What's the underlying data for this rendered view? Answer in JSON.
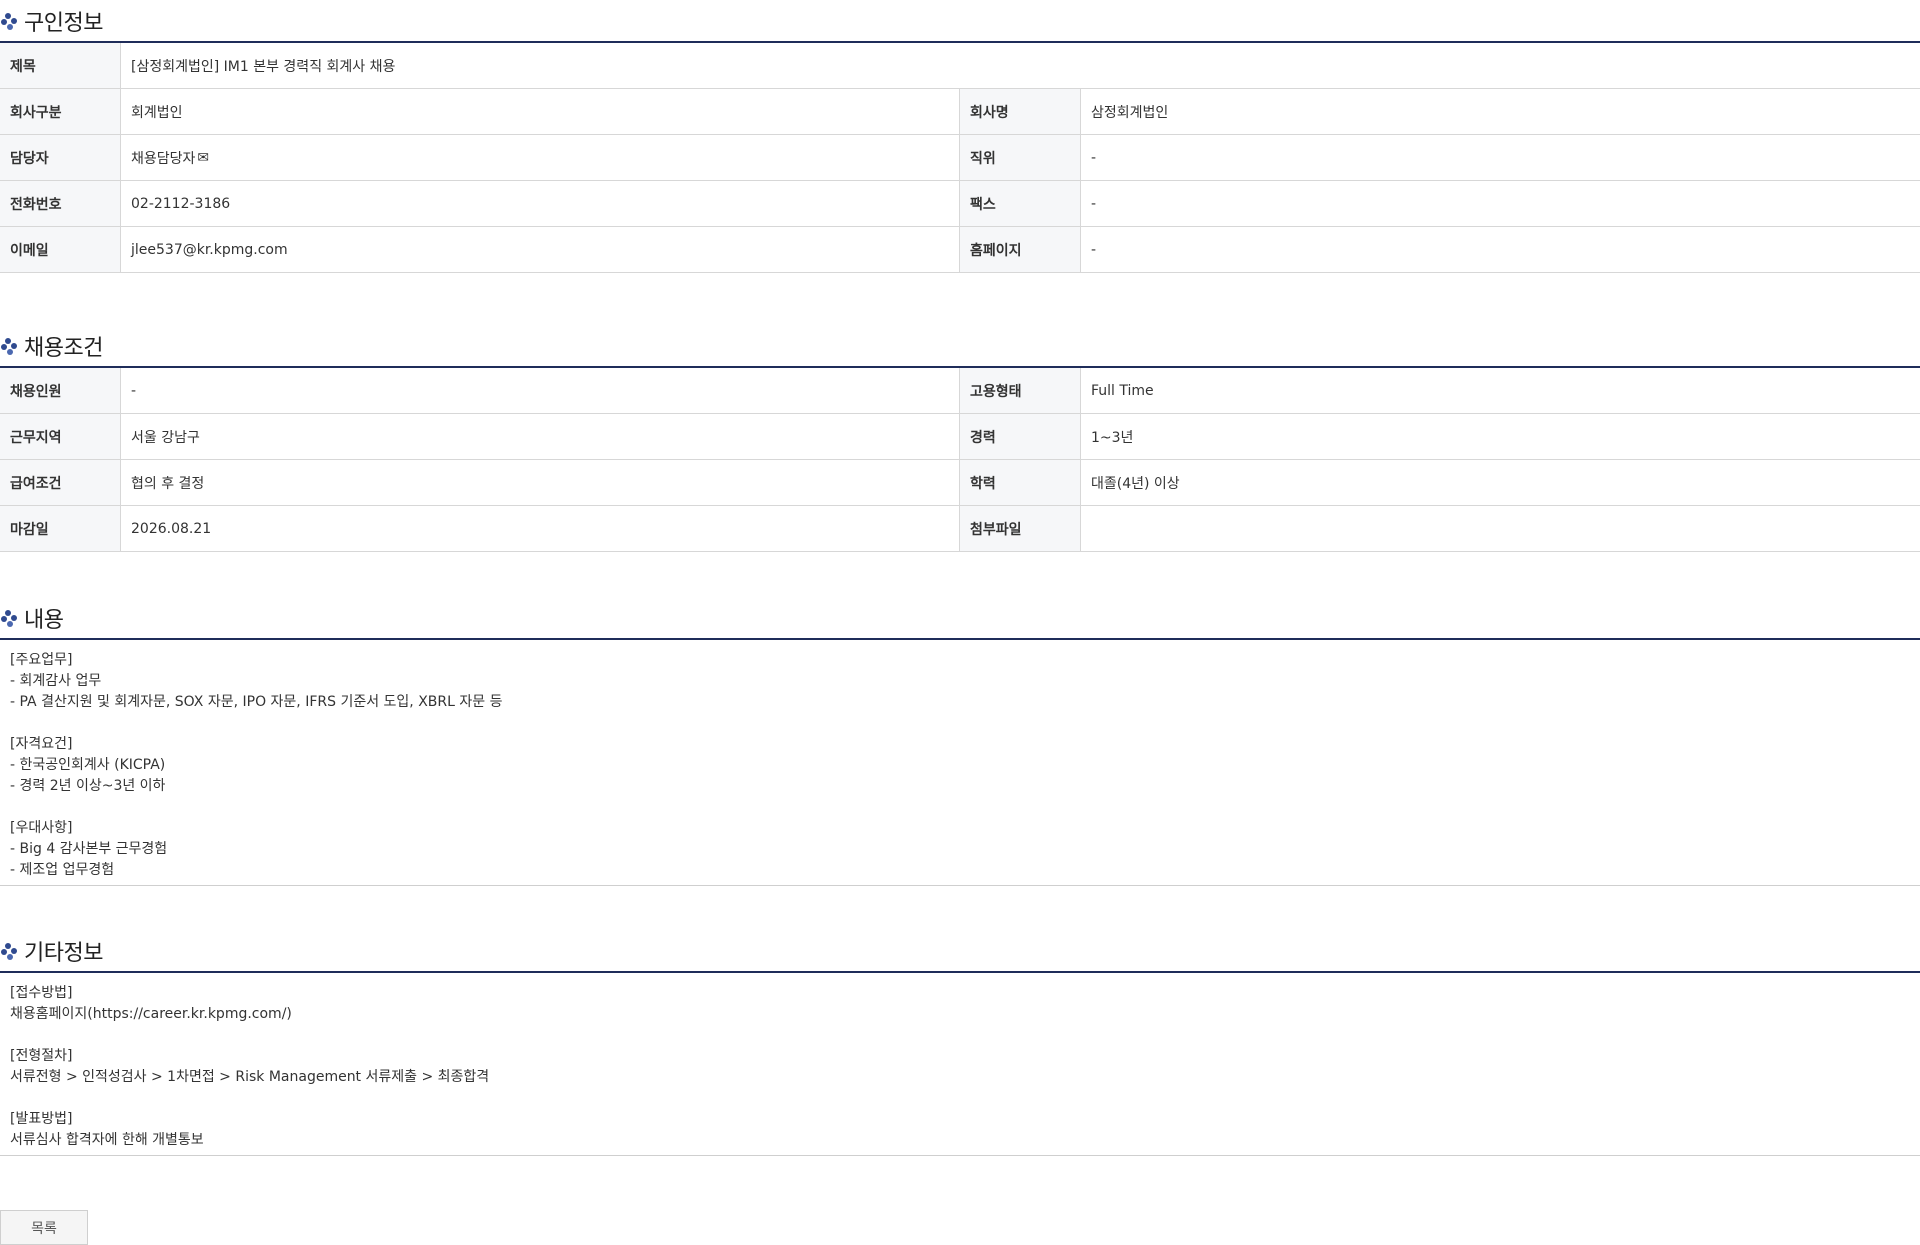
{
  "sections": {
    "job_info": {
      "title": "구인정보",
      "title_row": {
        "label": "제목",
        "value": "[삼정회계법인] IM1 본부 경력직 회계사 채용"
      },
      "rows": [
        {
          "label_l": "회사구분",
          "value_l": "회계법인",
          "label_r": "회사명",
          "value_r": "삼정회계법인"
        },
        {
          "label_l": "담당자",
          "value_l": "채용담당자",
          "label_r": "직위",
          "value_r": "-"
        },
        {
          "label_l": "전화번호",
          "value_l": "02-2112-3186",
          "label_r": "팩스",
          "value_r": "-"
        },
        {
          "label_l": "이메일",
          "value_l": "jlee537@kr.kpmg.com",
          "label_r": "홈페이지",
          "value_r": "-"
        }
      ],
      "contact_icon": "envelope-icon",
      "contact_icon_glyph": "✉"
    },
    "conditions": {
      "title": "채용조건",
      "rows": [
        {
          "label_l": "채용인원",
          "value_l": "-",
          "label_r": "고용형태",
          "value_r": "Full Time"
        },
        {
          "label_l": "근무지역",
          "value_l": "서울 강남구",
          "label_r": "경력",
          "value_r": "1~3년"
        },
        {
          "label_l": "급여조건",
          "value_l": "협의 후 결정",
          "label_r": "학력",
          "value_r": "대졸(4년) 이상"
        },
        {
          "label_l": "마감일",
          "value_l": "2026.08.21",
          "label_r": "첨부파일",
          "value_r": ""
        }
      ]
    },
    "content": {
      "title": "내용",
      "lines": [
        "[주요업무]",
        "- 회계감사 업무",
        "- PA 결산지원 및 회계자문, SOX 자문, IPO 자문, IFRS 기준서 도입, XBRL 자문 등",
        "",
        "[자격요건]",
        "- 한국공인회계사 (KICPA)",
        "- 경력 2년 이상~3년 이하",
        "",
        "[우대사항]",
        "- Big 4 감사본부 근무경험",
        "- 제조업 업무경험"
      ]
    },
    "etc": {
      "title": "기타정보",
      "lines": [
        "[접수방법]",
        "채용홈페이지(https://career.kr.kpmg.com/)",
        "",
        "[전형절차]",
        "서류전형 > 인적성검사 > 1차면접 > Risk Management 서류제출 > 최종합격",
        "",
        "[발표방법]",
        "서류심사 합격자에 한해 개별통보"
      ]
    }
  },
  "buttons": {
    "list_label": "목록"
  },
  "colors": {
    "accent_navy": "#1f2d5a",
    "header_cell_bg": "#f6f7f9",
    "border": "#d7d7d7"
  }
}
